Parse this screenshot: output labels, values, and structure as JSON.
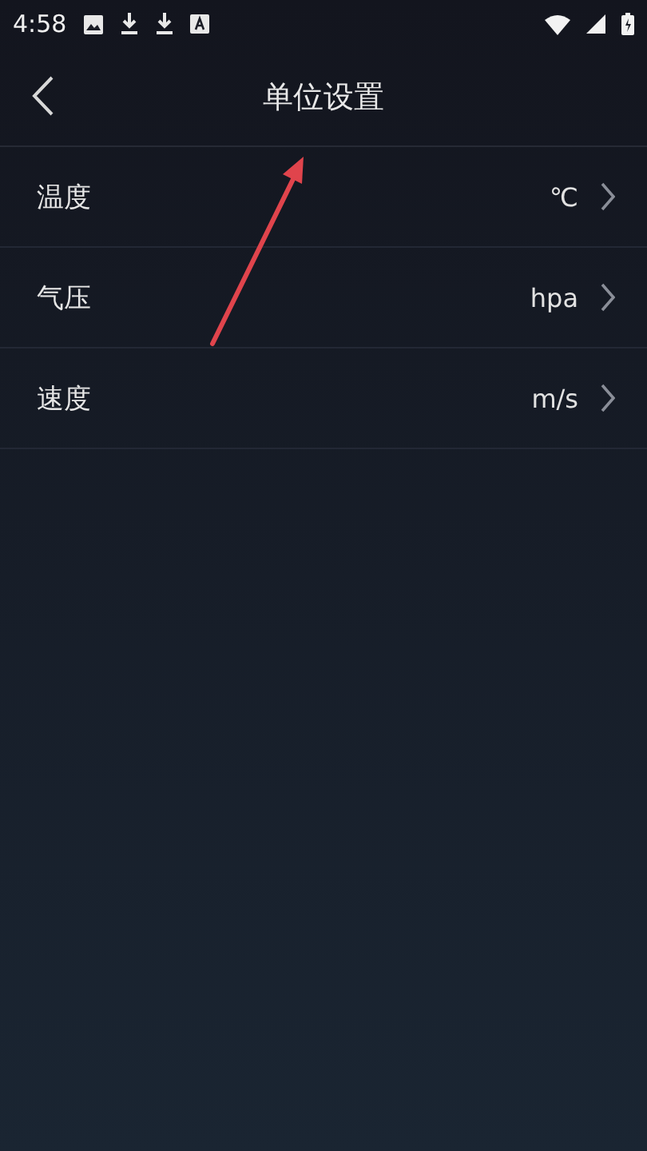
{
  "status_bar": {
    "time": "4:58"
  },
  "header": {
    "title": "单位设置"
  },
  "settings": [
    {
      "label": "温度",
      "value": "℃"
    },
    {
      "label": "气压",
      "value": "hpa"
    },
    {
      "label": "速度",
      "value": "m/s"
    }
  ]
}
